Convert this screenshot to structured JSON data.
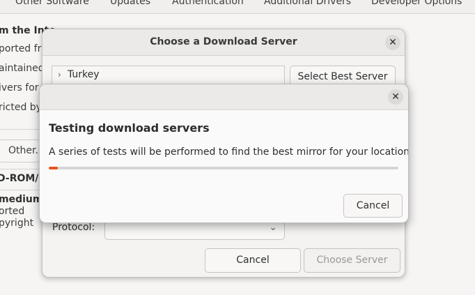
{
  "background_window": {
    "tabs": [
      "Other Software",
      "Updates",
      "Authentication",
      "Additional Drivers",
      "Developer Options"
    ],
    "heading_fragment": "m the Inte",
    "lines": [
      "ported fr",
      "aintained",
      "ivers for",
      "ricted by"
    ],
    "other_button": "Other.",
    "cdrom_label": "D-ROM/",
    "medium_label": "medium",
    "medium_lines": [
      "orted",
      "pyright"
    ]
  },
  "server_dialog": {
    "title": "Choose a Download Server",
    "close_icon": "close-icon",
    "tree_item": "Turkey",
    "select_best_button": "Select Best Server",
    "protocol_label": "Protocol:",
    "protocol_value": "",
    "cancel_button": "Cancel",
    "choose_button": "Choose Server"
  },
  "testing_dialog": {
    "close_icon": "close-icon",
    "heading": "Testing download servers",
    "description": "A series of tests will be performed to find the best mirror for your location.",
    "progress_fraction": 0.025,
    "progress_color": "#e95420",
    "cancel_button": "Cancel"
  }
}
